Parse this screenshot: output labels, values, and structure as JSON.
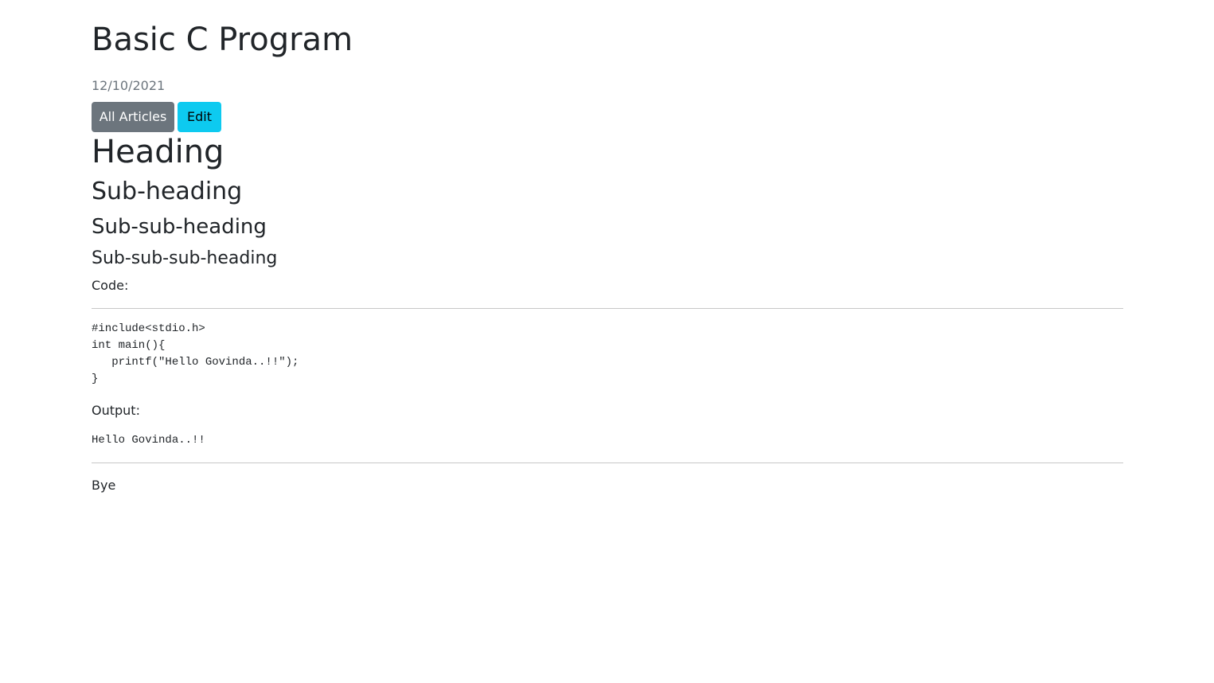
{
  "article": {
    "title": "Basic C Program",
    "date": "12/10/2021"
  },
  "actions": {
    "all_articles_label": "All Articles",
    "edit_label": "Edit"
  },
  "content": {
    "heading": "Heading",
    "sub_heading": "Sub-heading",
    "sub_sub_heading": "Sub-sub-heading",
    "sub_sub_sub_heading": "Sub-sub-sub-heading",
    "code_label": "Code:",
    "code": "#include<stdio.h>\nint main(){\n   printf(\"Hello Govinda..!!\");\n}",
    "output_label": "Output:",
    "output": "Hello Govinda..!!",
    "closing": "Bye"
  },
  "colors": {
    "secondary_button": "#6c757d",
    "info_button": "#0dcaf0",
    "text": "#212529",
    "muted": "#6c757d"
  }
}
